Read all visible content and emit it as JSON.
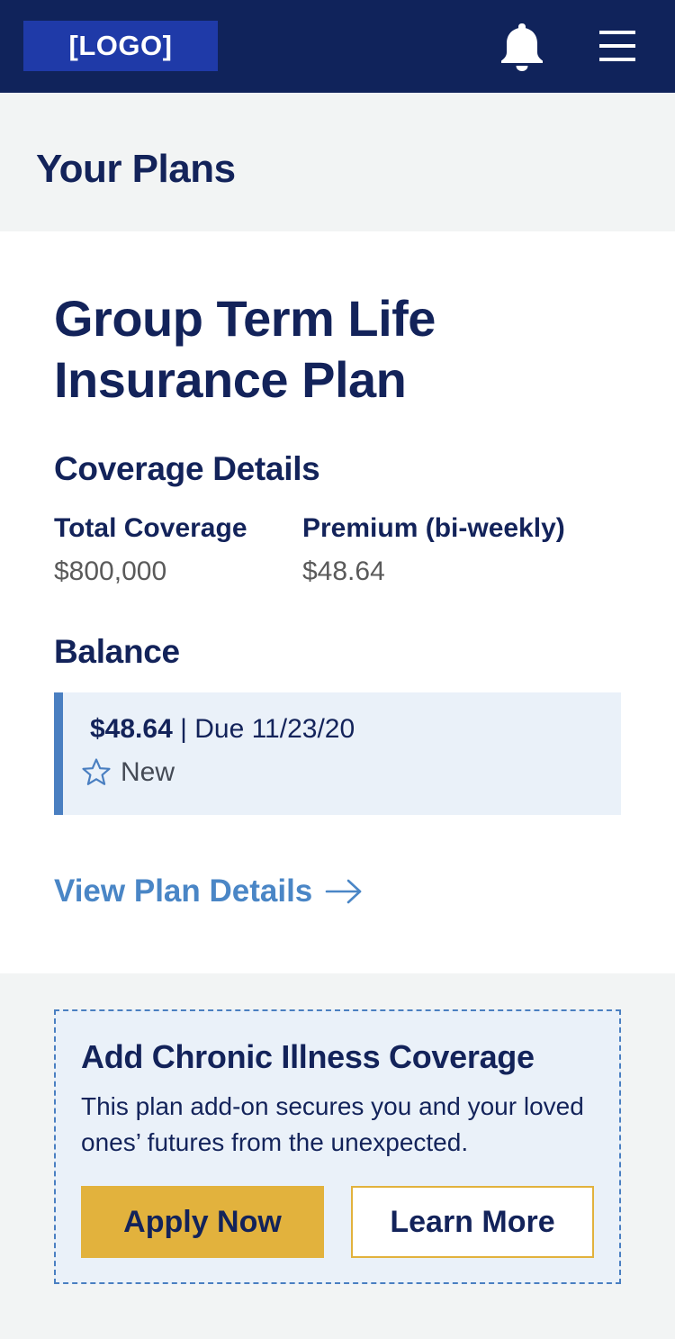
{
  "header": {
    "logo_text": "[LOGO]",
    "notification_icon": "bell-icon",
    "menu_icon": "hamburger-menu-icon"
  },
  "page": {
    "title": "Your Plans"
  },
  "plan": {
    "title": "Group Term Life Insurance Plan",
    "coverage_heading": "Coverage Details",
    "total_coverage_label": "Total Coverage",
    "total_coverage_value": "$800,000",
    "premium_label": "Premium (bi-weekly)",
    "premium_value": "$48.64",
    "balance_heading": "Balance",
    "balance_amount": "$48.64",
    "balance_separator": " | ",
    "balance_due": "Due 11/23/20",
    "balance_status": "New",
    "balance_status_icon": "star-outline-icon",
    "view_details_label": "View Plan Details",
    "view_details_icon": "arrow-right-icon"
  },
  "promo": {
    "title": "Add Chronic Illness Coverage",
    "text": "This plan add-on secures you and your loved ones’ futures from the unexpected.",
    "apply_label": "Apply Now",
    "learn_label": "Learn More"
  },
  "colors": {
    "header_bg": "#10235b",
    "logo_bg": "#1f3aa8",
    "heading": "#13235a",
    "link": "#4a86c6",
    "accent_bar": "#4a7fc1",
    "info_bg": "#eaf1f9",
    "button_gold": "#e2b23d",
    "page_bg": "#f2f4f4"
  }
}
